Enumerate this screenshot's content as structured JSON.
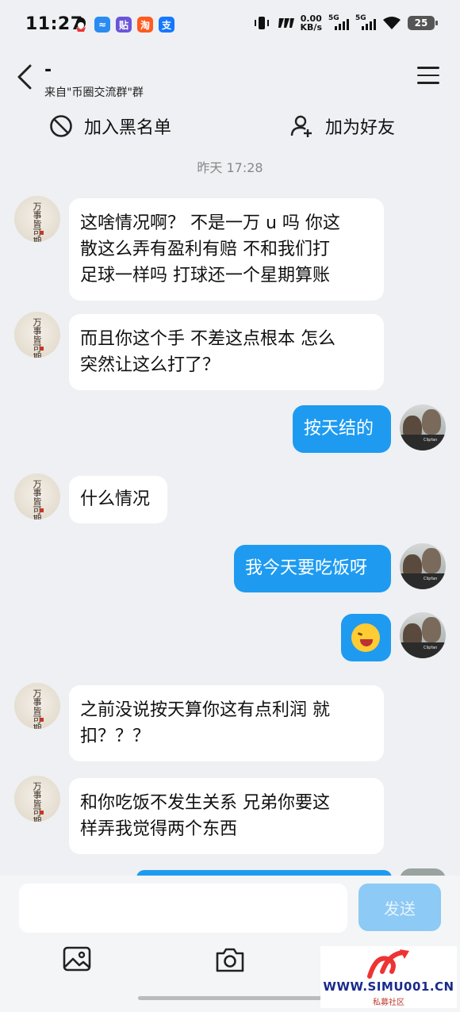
{
  "status_bar": {
    "time": "11:27",
    "net_speed_value": "0.00",
    "net_speed_unit": "KB/s",
    "sim1_label": "5G",
    "sim2_label": "5G",
    "battery": "25",
    "notification_icons": [
      "qq-icon",
      "fluid-app-icon",
      "tieba-icon",
      "taobao-icon",
      "alipay-icon"
    ],
    "notif_glyphs": {
      "tieba": "贴",
      "taobao": "淘",
      "alipay": "支"
    }
  },
  "header": {
    "title": "-",
    "subtitle": "来自\"币圈交流群\"群"
  },
  "actions": {
    "block_label": "加入黑名单",
    "add_friend_label": "加为好友"
  },
  "timestamp": "昨天 17:28",
  "messages": [
    {
      "side": "in",
      "lines": [
        "这啥情况啊？ 不是一万 u 吗 你这",
        "散这么弄有盈利有赔 不和我们打",
        "足球一样吗 打球还一个星期算账"
      ]
    },
    {
      "side": "in",
      "lines": [
        "而且你这个手 不差这点根本 怎么",
        "突然让这么打了？"
      ]
    },
    {
      "side": "out",
      "lines": [
        "按天结的"
      ]
    },
    {
      "side": "in",
      "lines": [
        "什么情况"
      ]
    },
    {
      "side": "out",
      "lines": [
        "我今天要吃饭呀"
      ]
    },
    {
      "side": "out",
      "emoji": "laughing-emoji"
    },
    {
      "side": "in",
      "lines": [
        "之前没说按天算你这有点利润 就",
        "扣？？？"
      ]
    },
    {
      "side": "in",
      "lines": [
        "和你吃饭不发生关系 兄弟你要这",
        "样弄我觉得两个东西"
      ]
    }
  ],
  "avatar_text": {
    "other_calligraphy": "万事皆可期",
    "me_caption": "Clipfan"
  },
  "input": {
    "placeholder": "",
    "send_label": "发送"
  },
  "toolbar": [
    "image-icon",
    "camera-icon"
  ],
  "watermark": {
    "url": "WWW.SIMU001.CN",
    "subtitle": "私募社区"
  },
  "colors": {
    "accent": "#1e9bf0",
    "send_disabled": "#8dcaf5",
    "background": "#eef0f3"
  }
}
